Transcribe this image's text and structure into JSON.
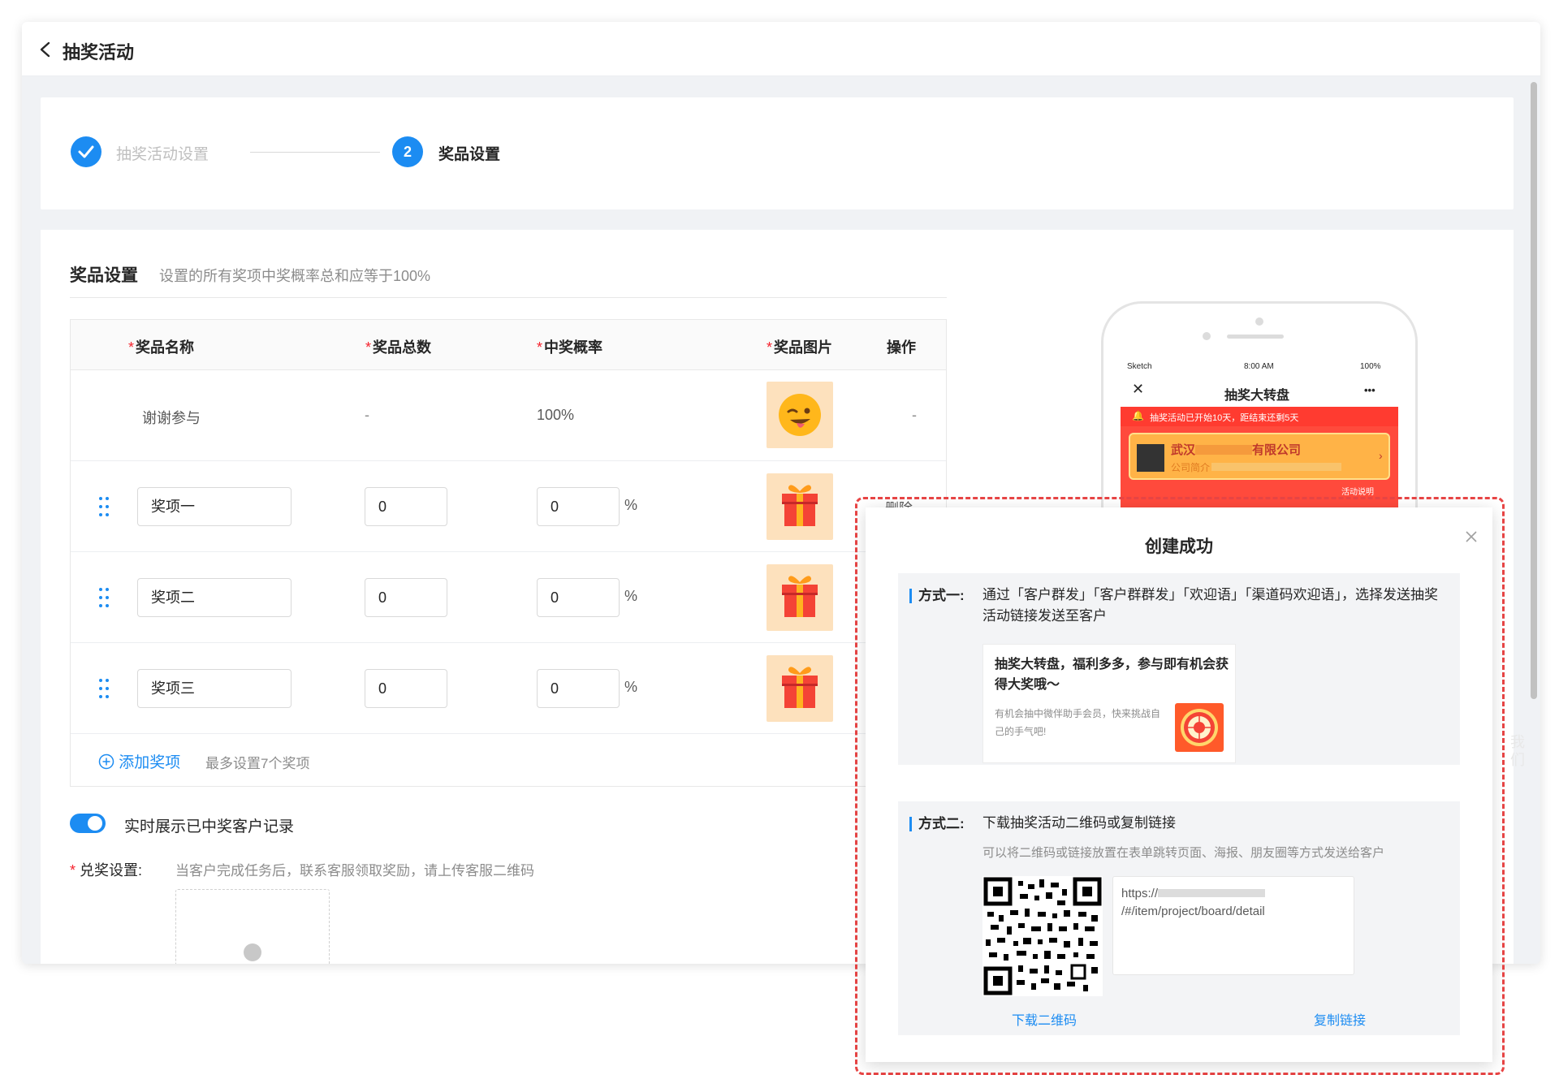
{
  "header": {
    "title": "抽奖活动"
  },
  "steps": [
    {
      "label": "抽奖活动设置",
      "state": "done"
    },
    {
      "number": "2",
      "label": "奖品设置",
      "state": "active"
    }
  ],
  "prize_settings": {
    "title": "奖品设置",
    "hint": "设置的所有奖项中奖概率总和应等于100%",
    "columns": [
      "奖品名称",
      "奖品总数",
      "中奖概率",
      "奖品图片",
      "操作"
    ],
    "fixed_row": {
      "name": "谢谢参与",
      "total": "-",
      "probability": "100%",
      "action": "-"
    },
    "rows": [
      {
        "name": "奖项一",
        "total": "0",
        "probability": "0",
        "unit": "%",
        "action": "删除"
      },
      {
        "name": "奖项二",
        "total": "0",
        "probability": "0",
        "unit": "%"
      },
      {
        "name": "奖项三",
        "total": "0",
        "probability": "0",
        "unit": "%"
      }
    ],
    "add_label": "添加奖项",
    "add_hint": "最多设置7个奖项",
    "toggle_label": "实时展示已中奖客户记录",
    "toggle_on": true,
    "redeem_label": "兑奖设置:",
    "redeem_hint": "当客户完成任务后，联系客服领取奖励，请上传客服二维码"
  },
  "phone_preview": {
    "carrier": "Sketch",
    "time": "8:00 AM",
    "battery": "100%",
    "title": "抽奖大转盘",
    "more": "•••",
    "notice": "抽奖活动已开始10天，距结束还剩5天",
    "company_prefix": "武汉",
    "company_suffix": "有限公司",
    "company_sub": "公司简介",
    "rules": "活动说明"
  },
  "side_text": "我们",
  "modal": {
    "title": "创建成功",
    "method1": {
      "label": "方式一:",
      "text": "通过「客户群发」「客户群群发」「欢迎语」「渠道码欢迎语」，选择发送抽奖活动链接发送至客户",
      "card_title": "抽奖大转盘，福利多多，参与即有机会获得大奖哦～",
      "card_desc": "有机会抽中微伴助手会员，快来挑战自己的手气吧!"
    },
    "method2": {
      "label": "方式二:",
      "text": "下载抽奖活动二维码或复制链接",
      "hint": "可以将二维码或链接放置在表单跳转页面、海报、朋友圈等方式发送给客户",
      "url_prefix": "https://",
      "url_suffix": "/#/item/project/board/detail",
      "download": "下载二维码",
      "copy": "复制链接"
    }
  },
  "colors": {
    "primary": "#1c8cf2",
    "required": "#f5222d",
    "dashed_border": "#e84545",
    "preview_red": "#ff3b30"
  }
}
